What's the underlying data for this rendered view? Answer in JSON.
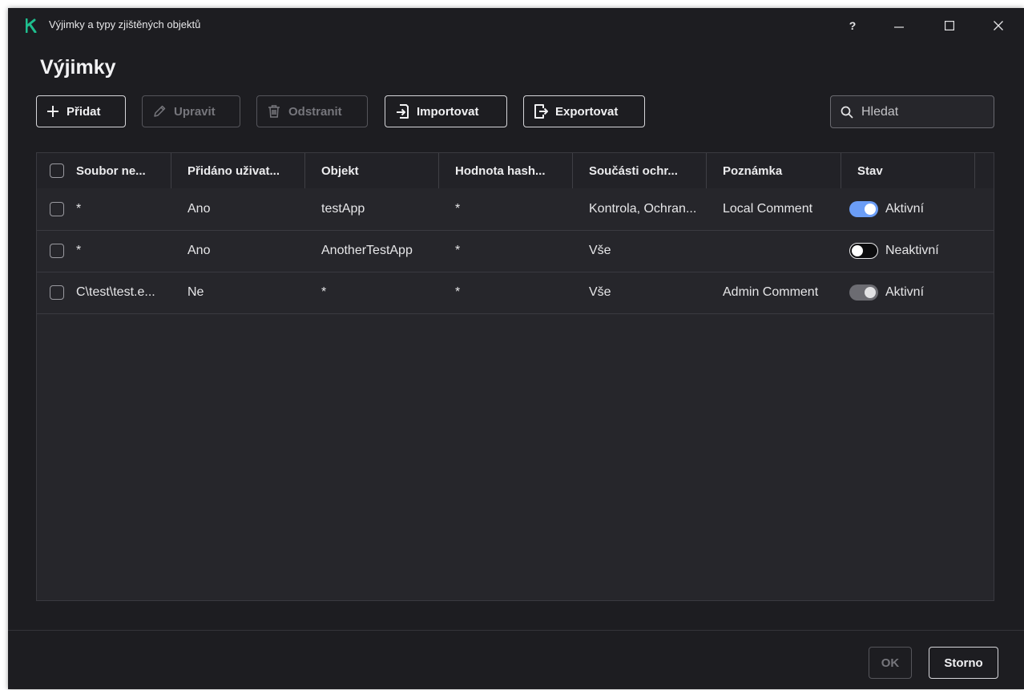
{
  "window": {
    "title": "Výjimky a typy zjištěných objektů",
    "help_label": "?",
    "accent_color": "#1fbe8e"
  },
  "page": {
    "title": "Výjimky"
  },
  "toolbar": {
    "add_label": "Přidat",
    "edit_label": "Upravit",
    "delete_label": "Odstranit",
    "import_label": "Importovat",
    "export_label": "Exportovat",
    "search_placeholder": "Hledat"
  },
  "table": {
    "columns": [
      "Soubor ne...",
      "Přidáno uživat...",
      "Objekt",
      "Hodnota hash...",
      "Součásti ochr...",
      "Poznámka",
      "Stav"
    ],
    "rows": [
      {
        "file": "*",
        "added_by_user": "Ano",
        "object": "testApp",
        "hash": "*",
        "components": "Kontrola, Ochran...",
        "comment": "Local Comment",
        "state": "Aktivní",
        "toggle": "on",
        "checked": false
      },
      {
        "file": "*",
        "added_by_user": "Ano",
        "object": "AnotherTestApp",
        "hash": "*",
        "components": "Vše",
        "comment": "",
        "state": "Neaktivní",
        "toggle": "off",
        "checked": false
      },
      {
        "file": "C\\test\\test.e...",
        "added_by_user": "Ne",
        "object": "*",
        "hash": "*",
        "components": "Vše",
        "comment": "Admin Comment",
        "state": "Aktivní",
        "toggle": "on-disabled",
        "checked": false
      }
    ]
  },
  "footer": {
    "ok_label": "OK",
    "cancel_label": "Storno"
  },
  "icons": {
    "logo": "kaspersky-k-logo",
    "add": "plus-icon",
    "edit": "pencil-icon",
    "delete": "trash-icon",
    "import": "import-icon",
    "export": "export-icon",
    "search": "search-icon"
  }
}
